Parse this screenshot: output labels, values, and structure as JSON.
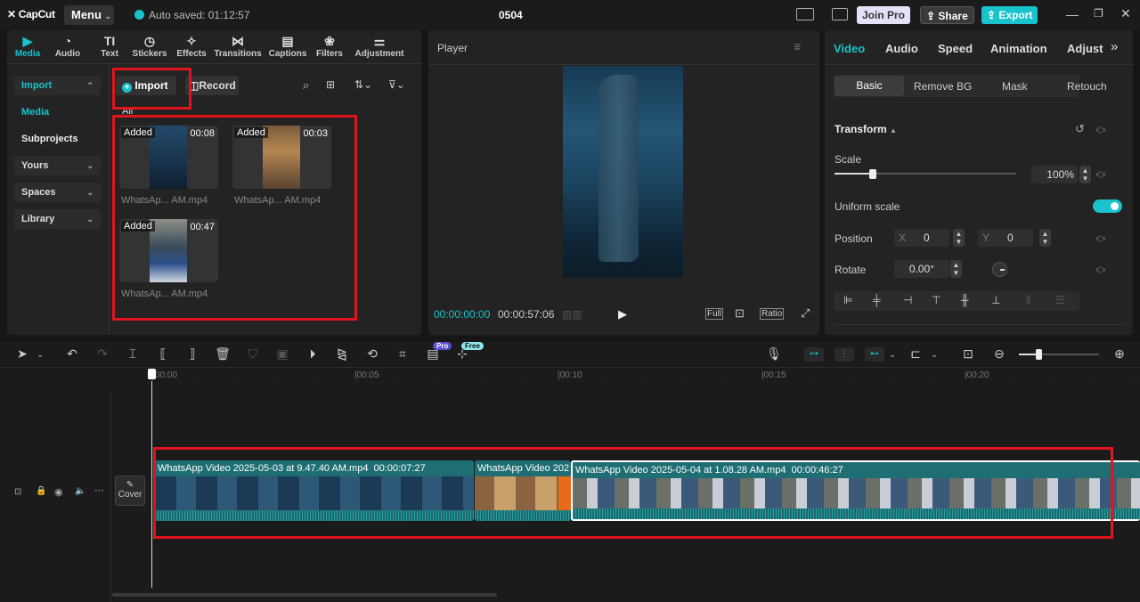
{
  "titlebar": {
    "logo": "CapCut",
    "menu": "Menu",
    "autosave": "Auto saved: 01:12:57",
    "project_title": "0504",
    "join_pro": "Join Pro",
    "share": "Share",
    "export": "Export"
  },
  "media_tabs": [
    {
      "label": "Media",
      "icon": "media-icon",
      "active": true
    },
    {
      "label": "Audio",
      "icon": "audio-icon"
    },
    {
      "label": "Text",
      "icon": "text-icon"
    },
    {
      "label": "Stickers",
      "icon": "stickers-icon"
    },
    {
      "label": "Effects",
      "icon": "effects-icon"
    },
    {
      "label": "Transitions",
      "icon": "transitions-icon"
    },
    {
      "label": "Captions",
      "icon": "captions-icon"
    },
    {
      "label": "Filters",
      "icon": "filters-icon"
    },
    {
      "label": "Adjustment",
      "icon": "adjustment-icon"
    }
  ],
  "sidebar": {
    "import": "Import",
    "media": "Media",
    "subprojects": "Subprojects",
    "yours": "Yours",
    "spaces": "Spaces",
    "library": "Library"
  },
  "media_toolbar": {
    "import_button": "Import",
    "record_button": "Record",
    "filter_all": "All"
  },
  "media_items": [
    {
      "badge": "Added",
      "duration": "00:08",
      "name": "WhatsAp... AM.mp4"
    },
    {
      "badge": "Added",
      "duration": "00:03",
      "name": "WhatsAp... AM.mp4"
    },
    {
      "badge": "Added",
      "duration": "00:47",
      "name": "WhatsAp... AM.mp4"
    }
  ],
  "player": {
    "title": "Player",
    "current_time": "00:00:00:00",
    "total_time": "00:00:57:06",
    "full": "Full",
    "ratio": "Ratio"
  },
  "props": {
    "tabs": [
      "Video",
      "Audio",
      "Speed",
      "Animation",
      "Adjust"
    ],
    "subtabs": [
      "Basic",
      "Remove BG",
      "Mask",
      "Retouch"
    ],
    "transform": "Transform",
    "scale_label": "Scale",
    "scale_value": "100%",
    "scale_level": 0.3,
    "uniform_scale": "Uniform scale",
    "position_label": "Position",
    "pos_x_label": "X",
    "pos_x": "0",
    "pos_y_label": "Y",
    "pos_y": "0",
    "rotate_label": "Rotate",
    "rotate_value": "0.00°"
  },
  "toolbar": {
    "pro_badge": "Pro",
    "free_badge": "Free"
  },
  "timeline": {
    "ruler": [
      "00:00",
      "|00:05",
      "|00:10",
      "|00:15",
      "|00:20"
    ],
    "cover": "Cover",
    "clips": [
      {
        "title": "WhatsApp Video 2025-05-03 at 9.47.40 AM.mp4",
        "duration": "00:00:07:27"
      },
      {
        "title": "WhatsApp Video 202",
        "duration": ""
      },
      {
        "title": "WhatsApp Video 2025-05-04 at 1.08.28 AM.mp4",
        "duration": "00:00:46:27"
      }
    ]
  },
  "colors": {
    "accent": "#19c3cc",
    "highlight_box": "#e0141e",
    "clip": "#1e6e73"
  }
}
